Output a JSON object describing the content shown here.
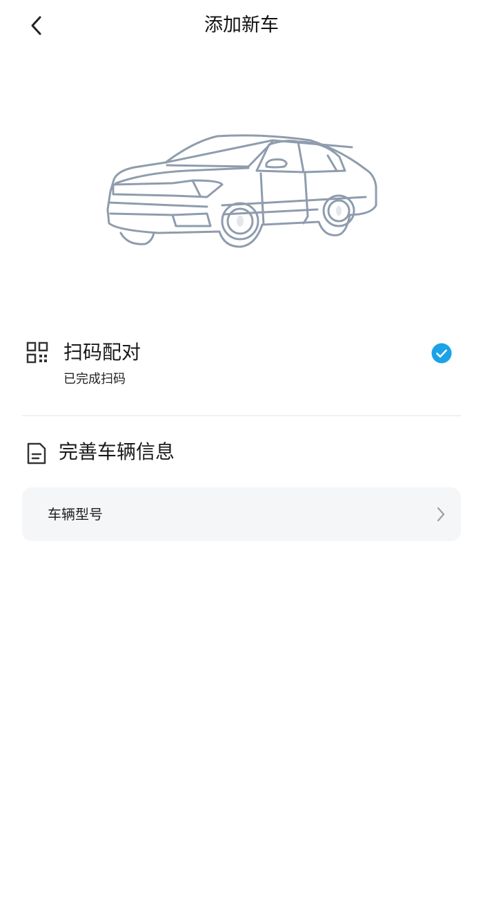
{
  "header": {
    "title": "添加新车",
    "back_icon": "chevron-left-icon"
  },
  "illustration": {
    "icon": "car-outline-illustration"
  },
  "steps": {
    "scan": {
      "icon": "qr-code-icon",
      "title": "扫码配对",
      "subtitle": "已完成扫码",
      "status_icon": "check-circle-icon",
      "status_color": "#1aa3e8"
    },
    "info": {
      "icon": "document-icon",
      "title": "完善车辆信息",
      "fields": [
        {
          "label": "车辆型号",
          "icon": "chevron-right-icon"
        }
      ]
    }
  }
}
